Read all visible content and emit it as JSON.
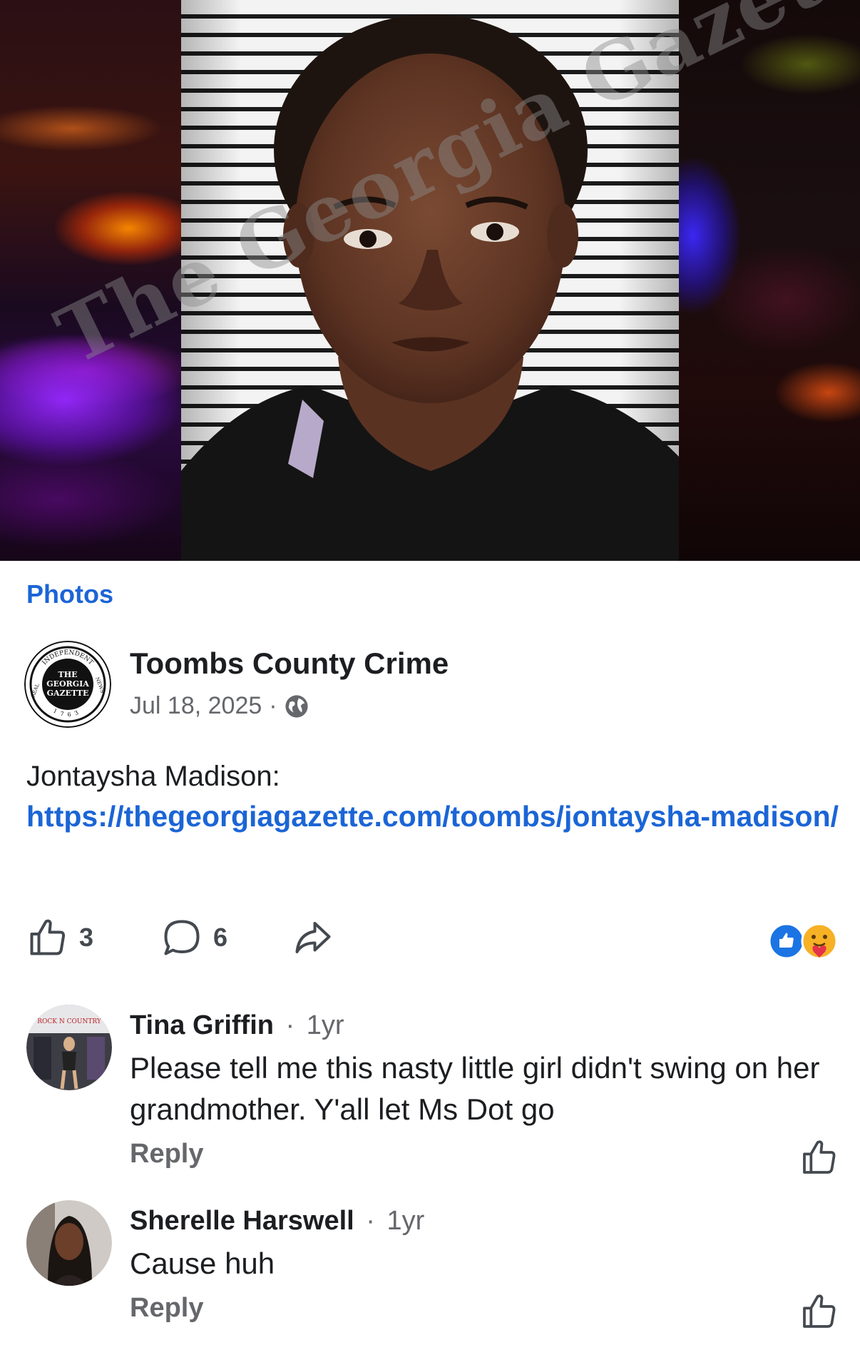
{
  "photo": {
    "watermark": "The Georgia Gazette"
  },
  "section_link": "Photos",
  "post": {
    "page_name": "Toombs County Crime",
    "date": "Jul 18, 2025",
    "separator": "·",
    "audience_icon": "globe-icon",
    "text": "Jontaysha Madison:",
    "link": "https://thegeorgiagazette.com/toombs/jontaysha-madison/",
    "avatar": {
      "top_arc": "INDEPENDENT",
      "left_arc": "REAL",
      "right_arc": "NEWS",
      "line1": "THE",
      "line2": "GEORGIA",
      "line3": "GAZETTE",
      "year": "1763"
    }
  },
  "actions": {
    "like_count": "3",
    "comment_count": "6",
    "like_icon": "thumbs-up-icon",
    "comment_icon": "comment-bubble-icon",
    "share_icon": "share-arrow-icon",
    "reaction_icons": [
      "like-reaction-icon",
      "care-reaction-icon"
    ]
  },
  "comments": [
    {
      "author": "Tina Griffin",
      "time": "1yr",
      "text": "Please tell me this nasty little girl didn't swing on her grandmother. Y'all let Ms Dot go",
      "reply_label": "Reply",
      "avatar_text": "ROCK N COUNTRY"
    },
    {
      "author": "Sherelle Harswell",
      "time": "1yr",
      "text": "Cause huh",
      "reply_label": "Reply"
    }
  ],
  "colors": {
    "link_blue": "#1b65d6",
    "text": "#1c1e21",
    "secondary": "#65676b"
  }
}
